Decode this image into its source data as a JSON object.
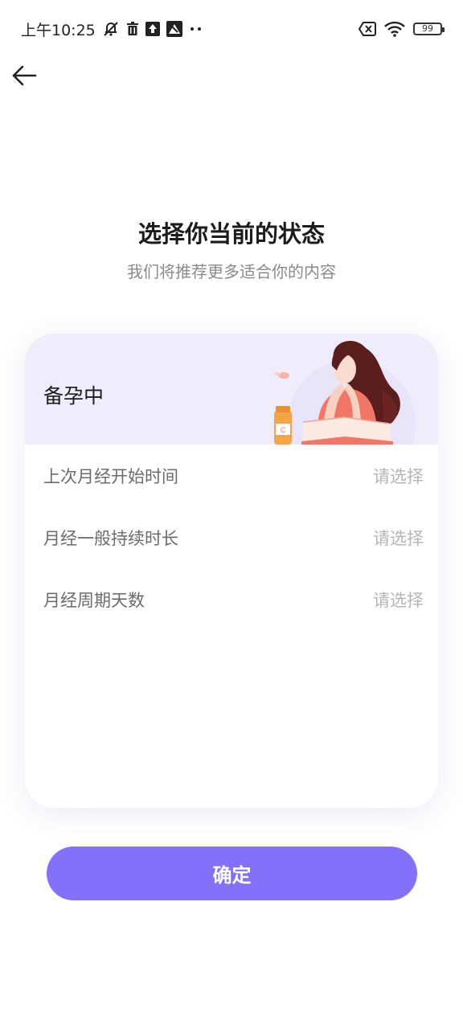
{
  "status_bar": {
    "time": "上午10:25",
    "battery_level": "99",
    "icons": [
      "bell-off-icon",
      "trash-icon",
      "upload-icon",
      "app-notification-icon",
      "more-dots-icon",
      "sim-error-icon",
      "wifi-icon",
      "battery-icon"
    ]
  },
  "nav": {
    "back_icon": "back-arrow-icon"
  },
  "header": {
    "title": "选择你当前的状态",
    "subtitle": "我们将推荐更多适合你的内容"
  },
  "card": {
    "title": "备孕中",
    "fields": [
      {
        "label": "上次月经开始时间",
        "value": "请选择"
      },
      {
        "label": "月经一般持续时长",
        "value": "请选择"
      },
      {
        "label": "月经周期天数",
        "value": "请选择"
      }
    ]
  },
  "actions": {
    "confirm_label": "确定"
  },
  "colors": {
    "accent": "#8371fb",
    "card_header_bg": "#efedfc",
    "placeholder": "#b5b5b5",
    "label": "#6b6b6b"
  }
}
